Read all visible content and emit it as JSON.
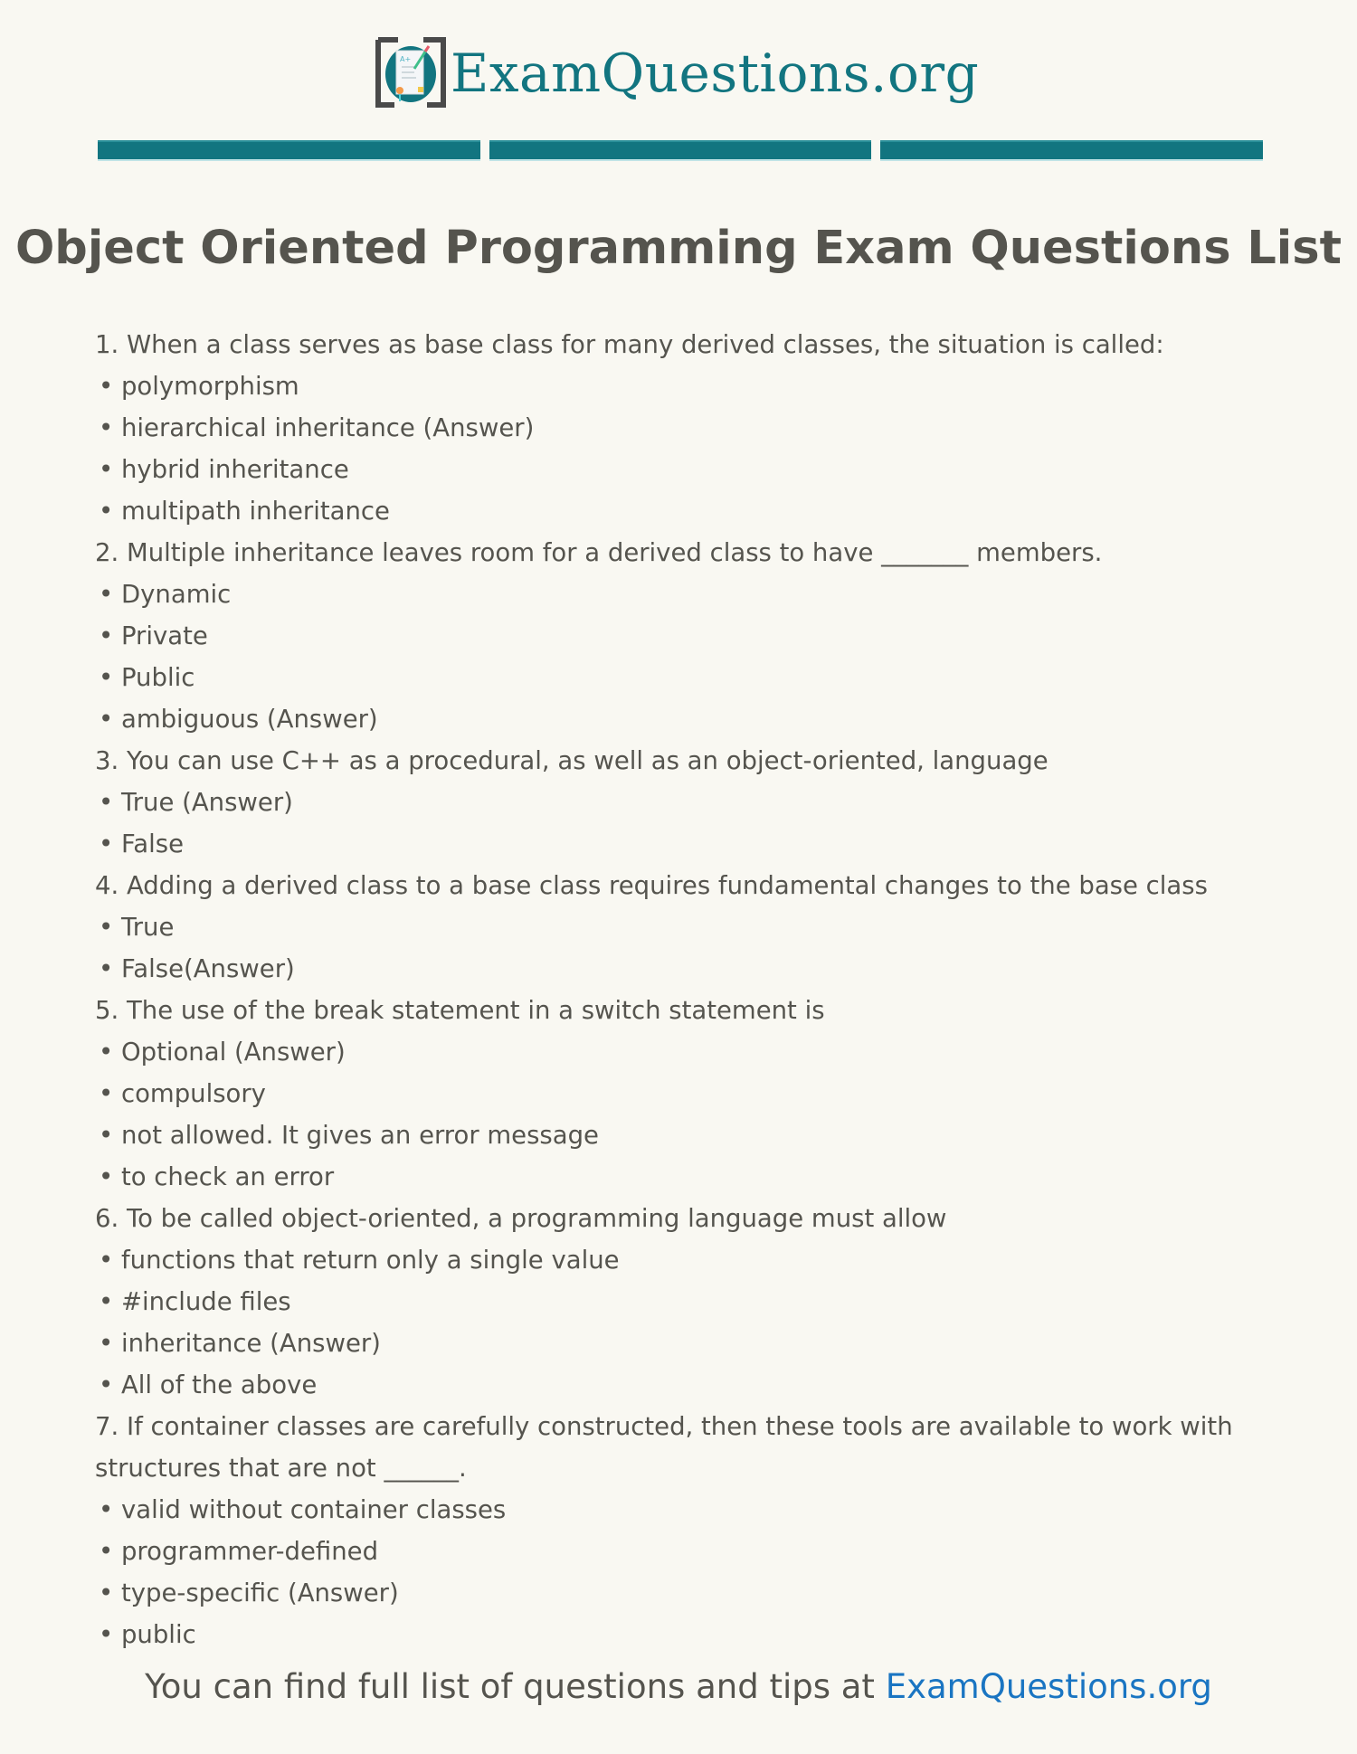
{
  "header": {
    "logo_text": "ExamQuestions.org",
    "logo_icon": "exam-paper-icon",
    "brand_color": "#127580"
  },
  "title": "Object Oriented Programming Exam Questions List",
  "questions": [
    {
      "text": "1. When a class serves as base class for many derived classes, the situation is called:",
      "options": [
        "• polymorphism",
        "• hierarchical inheritance (Answer)",
        "• hybrid inheritance",
        "• multipath inheritance"
      ]
    },
    {
      "text": "2. Multiple inheritance leaves room for a derived class to have _______ members.",
      "options": [
        "• Dynamic",
        "• Private",
        "• Public",
        "• ambiguous (Answer)"
      ]
    },
    {
      "text": "3. You can use C++ as a procedural, as well as an object-oriented, language",
      "options": [
        "• True (Answer)",
        "• False"
      ]
    },
    {
      "text": "4. Adding a derived class to a base class requires fundamental changes to the base class",
      "options": [
        "• True",
        "• False(Answer)"
      ]
    },
    {
      "text": "5. The use of the break statement in a switch statement is",
      "options": [
        "• Optional (Answer)",
        "• compulsory",
        "• not allowed. It gives an error message",
        "• to check an error"
      ]
    },
    {
      "text": "6. To be called object-oriented, a programming language must allow",
      "options": [
        "• functions that return only a single value",
        "• #include files",
        "• inheritance (Answer)",
        "• All of the above"
      ]
    },
    {
      "text": "7. If container classes are carefully constructed, then these tools are available to work with structures that are not ______.",
      "options": [
        "• valid without container classes",
        "• programmer-defined",
        "• type-specific (Answer)",
        "• public"
      ]
    }
  ],
  "footer": {
    "text": "You can find full list of questions and tips at ",
    "link_text": "ExamQuestions.org",
    "link_color": "#1a75c2"
  }
}
